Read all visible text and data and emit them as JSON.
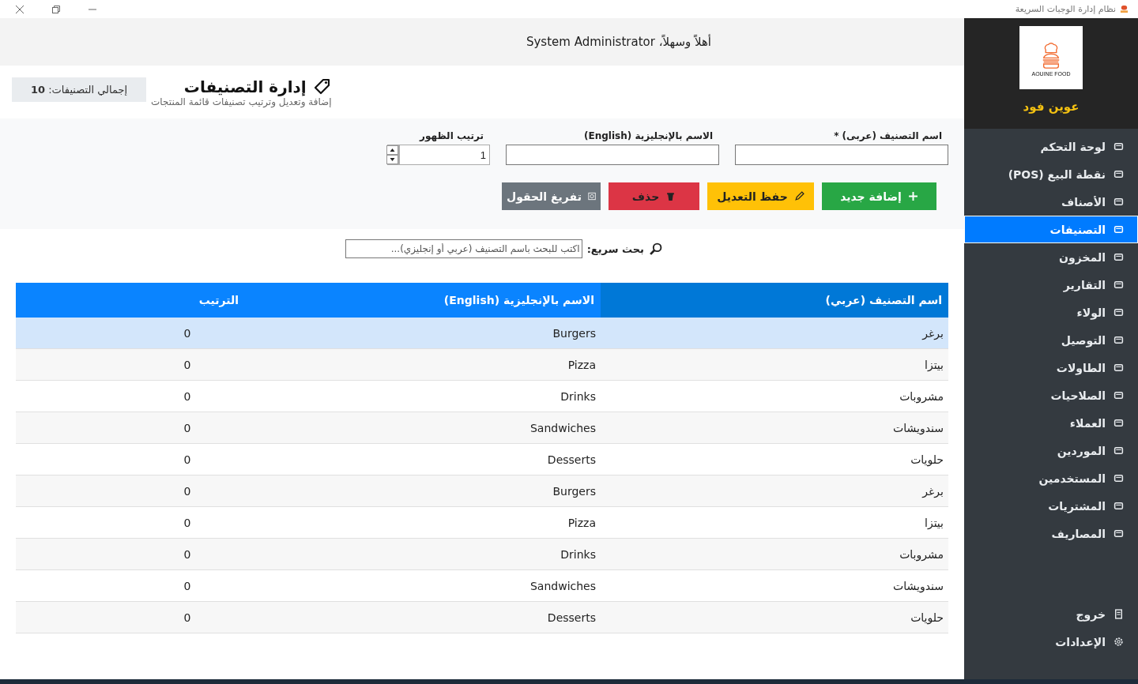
{
  "window": {
    "title": "نظام إدارة الوجبات السريعة"
  },
  "sidebar": {
    "logo_text": "AOUINE FOOD",
    "brand": "عوين فود",
    "items": [
      {
        "label": "لوحة التحكم",
        "selected": false
      },
      {
        "label": "نقطة البيع (POS)",
        "selected": false
      },
      {
        "label": "الأصناف",
        "selected": false
      },
      {
        "label": "التصنيفات",
        "selected": true
      },
      {
        "label": "المخزون",
        "selected": false
      },
      {
        "label": "التقارير",
        "selected": false
      },
      {
        "label": "الولاء",
        "selected": false
      },
      {
        "label": "التوصيل",
        "selected": false
      },
      {
        "label": "الطاولات",
        "selected": false
      },
      {
        "label": "الصلاحيات",
        "selected": false
      },
      {
        "label": "العملاء",
        "selected": false
      },
      {
        "label": "الموردين",
        "selected": false
      },
      {
        "label": "المستخدمين",
        "selected": false
      },
      {
        "label": "المشتريات",
        "selected": false
      },
      {
        "label": "المصاريف",
        "selected": false
      }
    ],
    "bottom_items": [
      {
        "label": "خروج"
      },
      {
        "label": "الإعدادات"
      }
    ]
  },
  "welcome": "أهلاً وسهلاً، System Administrator",
  "page": {
    "title": "إدارة التصنيفات",
    "subtitle": "إضافة وتعديل وترتيب تصنيفات قائمة المنتجات",
    "total": "إجمالي التصنيفات: **10**"
  },
  "form": {
    "fields": [
      {
        "label": "اسم التصنيف (عربى) *"
      },
      {
        "label": "الاسم بالإنجليزية (English)"
      }
    ],
    "order": {
      "label": "ترتيب الظهور",
      "value": "1"
    },
    "buttons": [
      {
        "label": "إضافة جديد",
        "kind": "add"
      },
      {
        "label": "حفظ التعديل",
        "kind": "edit"
      },
      {
        "label": "حذف",
        "kind": "delete"
      },
      {
        "label": "تفريغ الحقول",
        "kind": "clear"
      }
    ]
  },
  "search": {
    "label": "بحث سريع:",
    "placeholder": "اكتب للبحث باسم التصنيف (عربي أو إنجليزي)..."
  },
  "table": {
    "columns": [
      "اسم التصنيف (عربي)",
      "الاسم بالإنجليزية (English)",
      "الترتيب"
    ],
    "rows": [
      {
        "cells": [
          "برغر",
          "Burgers",
          "0"
        ],
        "selected": true
      },
      {
        "cells": [
          "بيتزا",
          "Pizza",
          "0"
        ],
        "selected": false
      },
      {
        "cells": [
          "مشروبات",
          "Drinks",
          "0"
        ],
        "selected": false
      },
      {
        "cells": [
          "سندويشات",
          "Sandwiches",
          "0"
        ],
        "selected": false
      },
      {
        "cells": [
          "حلويات",
          "Desserts",
          "0"
        ],
        "selected": false
      },
      {
        "cells": [
          "برغر",
          "Burgers",
          "0"
        ],
        "selected": false
      },
      {
        "cells": [
          "بيتزا",
          "Pizza",
          "0"
        ],
        "selected": false
      },
      {
        "cells": [
          "مشروبات",
          "Drinks",
          "0"
        ],
        "selected": false
      },
      {
        "cells": [
          "سندويشات",
          "Sandwiches",
          "0"
        ],
        "selected": false
      },
      {
        "cells": [
          "حلويات",
          "Desserts",
          "0"
        ],
        "selected": false
      }
    ]
  }
}
